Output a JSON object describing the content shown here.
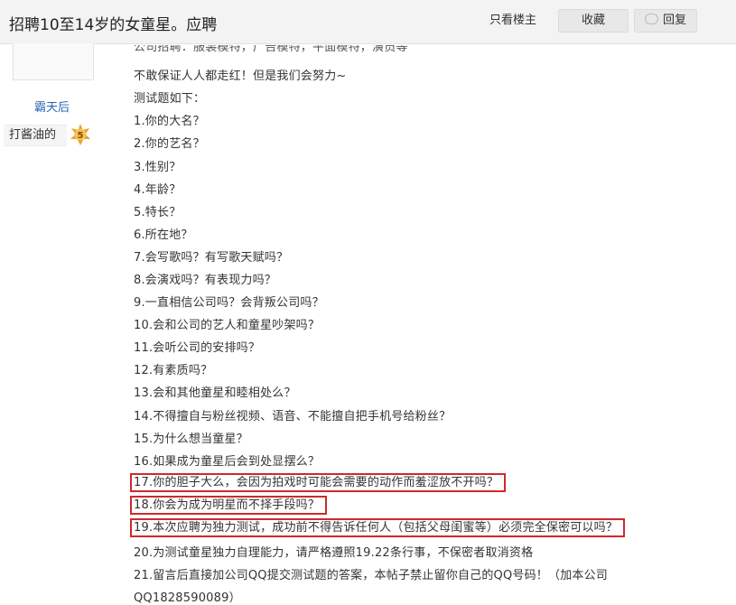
{
  "header": {
    "title": "招聘10至14岁的女童星。应聘",
    "only_op_label": "只看楼主",
    "favorite_label": "收藏",
    "reply_label": "回复"
  },
  "author": {
    "username": "霸天后",
    "level_name": "打酱油的",
    "level": "5"
  },
  "post": {
    "lines": [
      "公司招聘：服装模特，广告模特，平面模特，演员等",
      "不敢保证人人都走红！但是我们会努力~",
      "测试题如下：",
      "1.你的大名？",
      "2.你的艺名？",
      "3.性别？",
      "4.年龄？",
      "5.特长？",
      "6.所在地？",
      "7.会写歌吗？有写歌天赋吗？",
      "8.会演戏吗？有表现力吗？",
      "9.一直相信公司吗？会背叛公司吗？",
      "10.会和公司的艺人和童星吵架吗？",
      "11.会听公司的安排吗？",
      "12.有素质吗？",
      "13.会和其他童星和睦相处么？",
      "14.不得擅自与粉丝视频、语音、不能擅自把手机号给粉丝？",
      "15.为什么想当童星？",
      "16.如果成为童星后会到处显摆么？",
      "17.你的胆子大么，会因为拍戏时可能会需要的动作而羞涩放不开吗？",
      "18.你会为成为明星而不择手段吗？",
      "19.本次应聘为独力测试，成功前不得告诉任何人（包括父母闺蜜等）必须完全保密可以吗？",
      "20.为测试童星独力自理能力，请严格遵照19.22条行事，不保密者取消资格",
      "21.留言后直接加公司QQ提交测试题的答案，本帖子禁止留你自己的QQ号码！（加本公司",
      "QQ1828590089）"
    ]
  },
  "colors": {
    "highlight_box": "#d0282d",
    "username": "#2d64b3",
    "level_badge": "#e8a325"
  },
  "icons": [
    "reply-icon",
    "level-badge-icon"
  ]
}
